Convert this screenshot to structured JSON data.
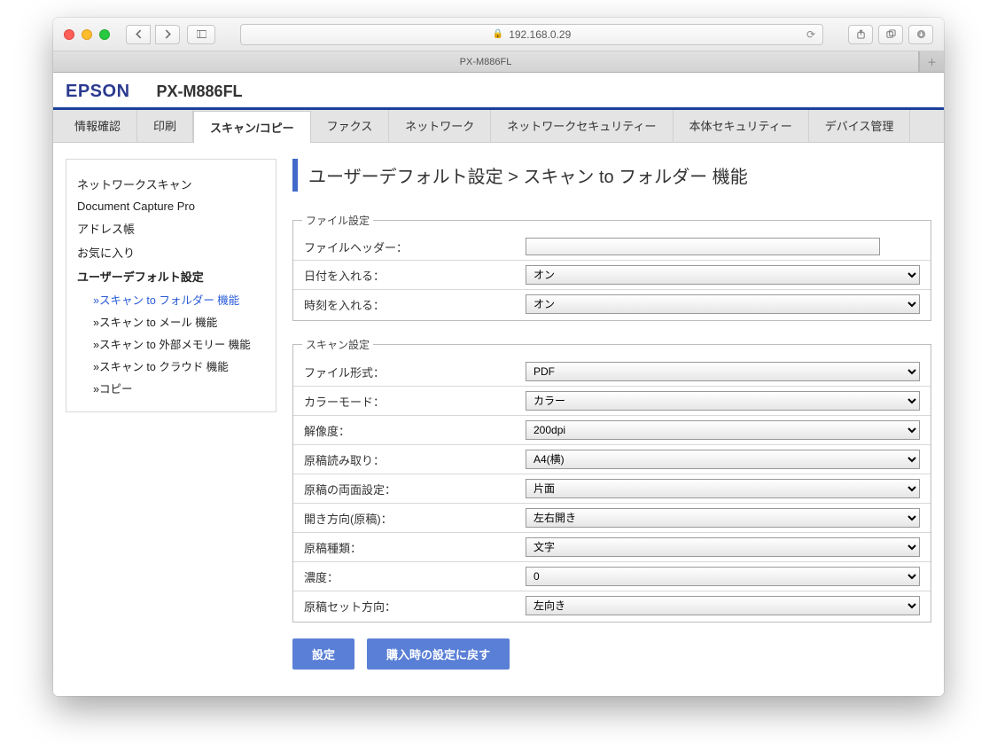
{
  "browser": {
    "address": "192.168.0.29",
    "tab_title": "PX-M886FL"
  },
  "header": {
    "brand": "EPSON",
    "model": "PX-M886FL"
  },
  "maintabs": [
    "情報確認",
    "印刷",
    "スキャン/コピー",
    "ファクス",
    "ネットワーク",
    "ネットワークセキュリティー",
    "本体セキュリティー",
    "デバイス管理"
  ],
  "sidebar": {
    "items": [
      "ネットワークスキャン",
      "Document Capture Pro",
      "アドレス帳",
      "お気に入り",
      "ユーザーデフォルト設定"
    ],
    "subitems": [
      "スキャン to フォルダー 機能",
      "スキャン to メール 機能",
      "スキャン to 外部メモリー 機能",
      "スキャン to クラウド 機能",
      "コピー"
    ]
  },
  "page_title": "ユーザーデフォルト設定 > スキャン to フォルダー 機能",
  "fieldset1": {
    "legend": "ファイル設定",
    "rows": {
      "file_header_label": "ファイルヘッダー：",
      "file_header_value": "",
      "date_label": "日付を入れる：",
      "date_value": "オン",
      "time_label": "時刻を入れる：",
      "time_value": "オン"
    }
  },
  "fieldset2": {
    "legend": "スキャン設定",
    "rows": {
      "format_label": "ファイル形式：",
      "format_value": "PDF",
      "color_label": "カラーモード：",
      "color_value": "カラー",
      "res_label": "解像度：",
      "res_value": "200dpi",
      "read_label": "原稿読み取り：",
      "read_value": "A4(横)",
      "duplex_label": "原稿の両面設定：",
      "duplex_value": "片面",
      "binding_label": "開き方向(原稿)：",
      "binding_value": "左右開き",
      "type_label": "原稿種類：",
      "type_value": "文字",
      "density_label": "濃度：",
      "density_value": "0",
      "orient_label": "原稿セット方向：",
      "orient_value": "左向き"
    }
  },
  "buttons": {
    "apply": "設定",
    "reset": "購入時の設定に戻す"
  }
}
